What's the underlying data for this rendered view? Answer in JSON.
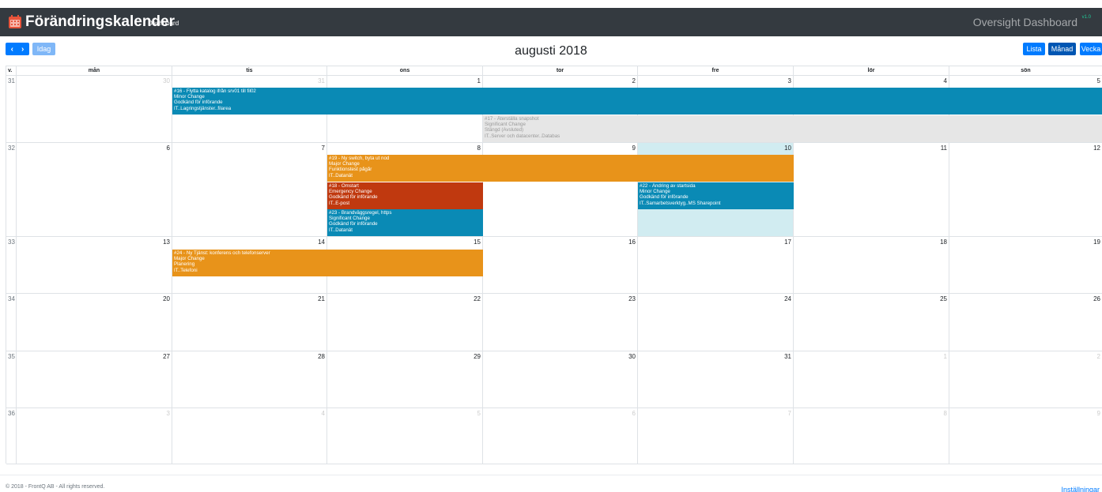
{
  "app": {
    "title": "Förändringskalender",
    "subtitle": "Dashboard",
    "overview": "Oversight Dashboard",
    "overview_version": "v1.0"
  },
  "toolbar": {
    "prev_label": "‹",
    "next_label": "›",
    "today_label": "Idag",
    "list_label": "Lista",
    "month_label": "Månad",
    "week_label": "Vecka"
  },
  "calendar": {
    "title": "augusti 2018",
    "headers": [
      "v.",
      "mån",
      "tis",
      "ons",
      "tor",
      "fre",
      "lör",
      "sön"
    ],
    "weeks": [
      {
        "num": "31",
        "days": [
          "30",
          "31",
          "1",
          "2",
          "3",
          "4",
          "5"
        ]
      },
      {
        "num": "32",
        "days": [
          "6",
          "7",
          "8",
          "9",
          "10",
          "11",
          "12"
        ]
      },
      {
        "num": "33",
        "days": [
          "13",
          "14",
          "15",
          "16",
          "17",
          "18",
          "19"
        ]
      },
      {
        "num": "34",
        "days": [
          "20",
          "21",
          "22",
          "23",
          "24",
          "25",
          "26"
        ]
      },
      {
        "num": "35",
        "days": [
          "27",
          "28",
          "29",
          "30",
          "31",
          "1",
          "2"
        ]
      },
      {
        "num": "36",
        "days": [
          "3",
          "4",
          "5",
          "6",
          "7",
          "8",
          "9"
        ]
      }
    ]
  },
  "events": [
    {
      "lines": [
        "#16 - Flytta katalog ifrån srv01 till fil02",
        "Minor Change",
        "Godkänd för införande",
        "IT..Lagringstjänster..filarea"
      ],
      "color": "#0a8ab5"
    },
    {
      "lines": [
        "#17 - Återställa snapshot",
        "Significant Change",
        "Stängd (Avsluted)",
        "IT..Server och datacenter..Databas"
      ],
      "color": "#e6e6e6"
    },
    {
      "lines": [
        "#19 - Ny switch, byta ut nod",
        "Major Change",
        "Funktionstest pågår",
        "IT..Datanät"
      ],
      "color": "#e8931a"
    },
    {
      "lines": [
        "#18 - Omstart",
        "Emergency Change",
        "Godkänd för införande",
        "IT..E-post"
      ],
      "color": "#c0390f"
    },
    {
      "lines": [
        "#23 - Brandväggsregel, https",
        "Significant Change",
        "Godkänd för införande",
        "IT..Datanät"
      ],
      "color": "#0a8ab5"
    },
    {
      "lines": [
        "#22 - Ändring av startsida",
        "Minor Change",
        "Godkänd för införande",
        "IT..Samarbetsverktyg..MS Sharepoint"
      ],
      "color": "#0a8ab5"
    },
    {
      "lines": [
        "#24 - Ny Tjänst: konferens och telefonserver",
        "Major Change",
        "Planering",
        "IT..Telefoni"
      ],
      "color": "#e8931a"
    }
  ],
  "footer": {
    "copyright": "© 2018 - FrontQ AB - All rights reserved.",
    "settings": "Inställningar"
  }
}
